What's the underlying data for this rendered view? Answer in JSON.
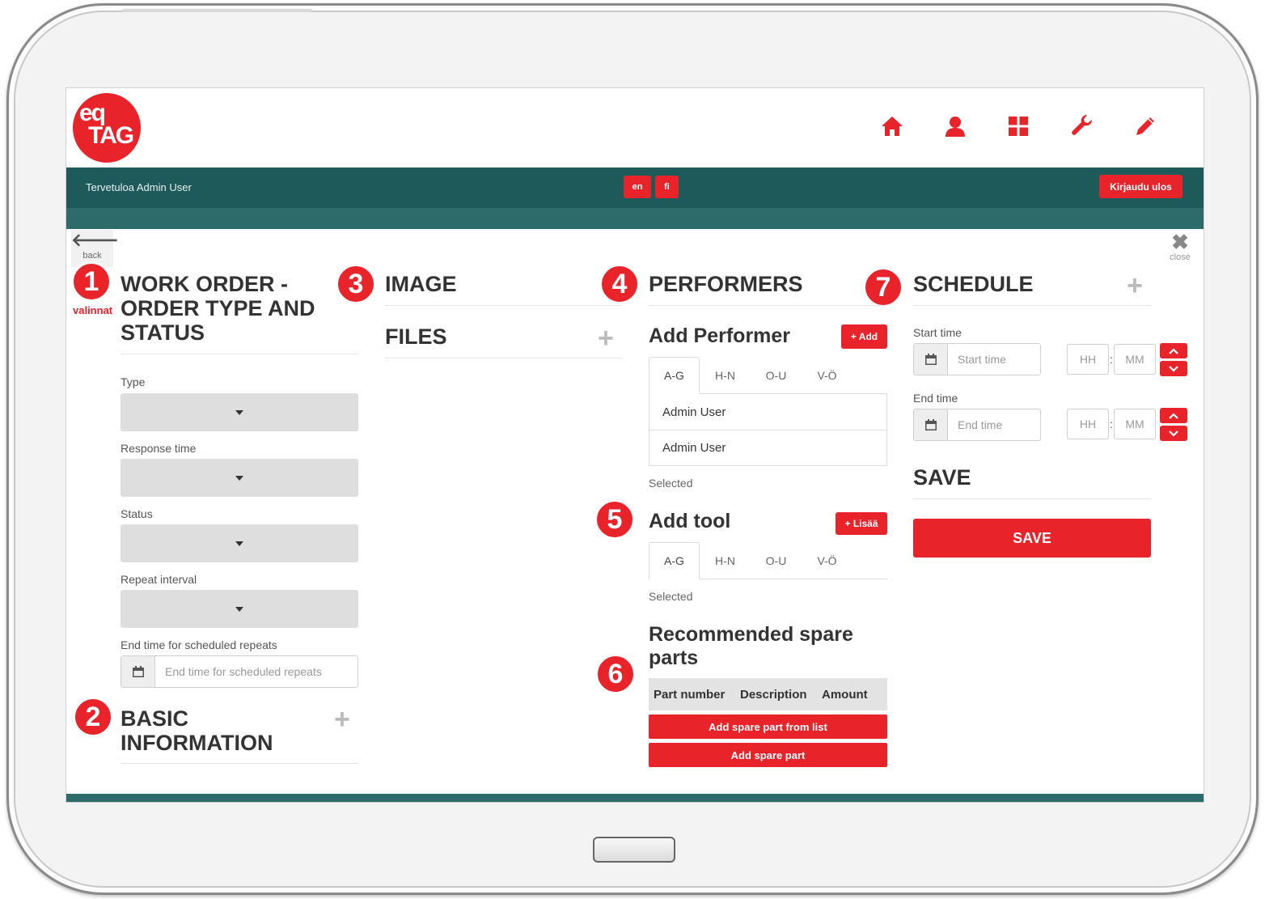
{
  "header": {
    "logo_line1": "eq",
    "logo_line2": "TAG",
    "nav_icons": [
      "home-icon",
      "user-icon",
      "grid-icon",
      "wrench-icon",
      "pencil-icon"
    ],
    "greeting": "Tervetuloa Admin User",
    "languages": [
      "en",
      "fi"
    ],
    "logout_label": "Kirjaudu ulos"
  },
  "colors": {
    "accent": "#e8232a",
    "teal_dark": "#1f5a5a",
    "teal": "#2d6b6b"
  },
  "nav": {
    "back_label": "back",
    "close_label": "close"
  },
  "badges": [
    "1",
    "2",
    "3",
    "4",
    "5",
    "6",
    "7"
  ],
  "annotation": "valinnat",
  "work_order": {
    "title_line1": "WORK ORDER -",
    "title_line2": "ORDER TYPE AND",
    "title_line3": "STATUS",
    "type_label": "Type",
    "response_label": "Response time",
    "status_label": "Status",
    "repeat_label": "Repeat interval",
    "end_repeat_label": "End time for scheduled repeats",
    "end_repeat_placeholder": "End time for scheduled repeats"
  },
  "basic_info": {
    "title_line1": "BASIC",
    "title_line2": "INFORMATION"
  },
  "image": {
    "title": "IMAGE"
  },
  "files": {
    "title": "FILES"
  },
  "performers": {
    "title": "PERFORMERS",
    "add_title": "Add Performer",
    "add_button": "+ Add",
    "tabs": [
      "A-G",
      "H-N",
      "O-U",
      "V-Ö"
    ],
    "users": [
      "Admin User",
      "Admin User"
    ],
    "selected_label": "Selected"
  },
  "tools": {
    "title": "Add tool",
    "add_button": "+ Lisää",
    "tabs": [
      "A-G",
      "H-N",
      "O-U",
      "V-Ö"
    ],
    "selected_label": "Selected"
  },
  "spare_parts": {
    "title_line1": "Recommended spare",
    "title_line2": "parts",
    "columns": [
      "Part number",
      "Description",
      "Amount"
    ],
    "add_from_list": "Add spare part from list",
    "add_part": "Add spare part"
  },
  "schedule": {
    "title": "SCHEDULE",
    "start_label": "Start time",
    "start_placeholder": "Start time",
    "end_label": "End time",
    "end_placeholder": "End time",
    "hh": "HH",
    "mm": "MM",
    "sep": ":"
  },
  "save": {
    "title": "SAVE",
    "button": "SAVE"
  }
}
